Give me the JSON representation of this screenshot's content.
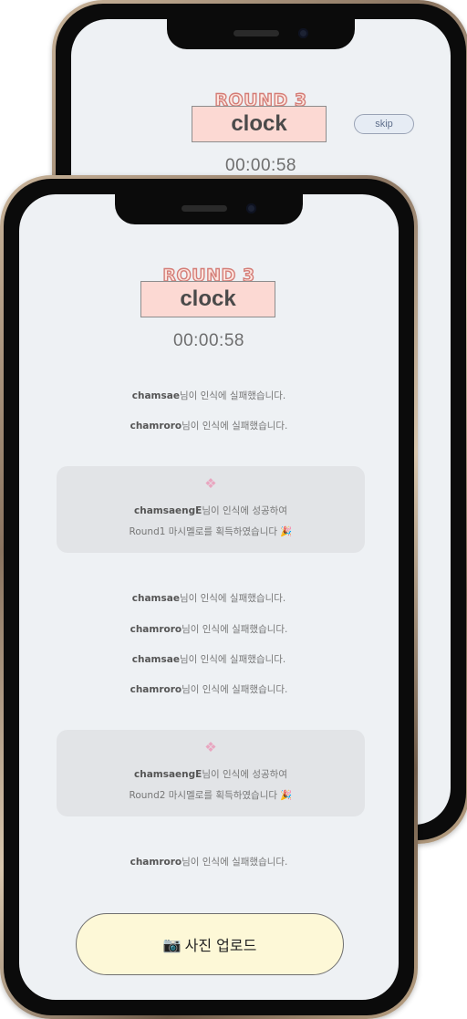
{
  "game": {
    "round_label": "ROUND 3",
    "word": "clock",
    "timer": "00:00:58",
    "skip_label": "skip"
  },
  "feed": [
    {
      "type": "fail",
      "user": "chamsae",
      "text": "님이 인식에 실패했습니다."
    },
    {
      "type": "fail",
      "user": "chamroro",
      "text": "님이 인식에 실패했습니다."
    },
    {
      "type": "success",
      "icon": "marshmallow-icon",
      "user": "chamsaengE",
      "text": "님이 인식에 성공하여",
      "reward": "Round1 마시멜로를 획득하였습니다",
      "reward_icon": "party-popper-icon"
    },
    {
      "type": "fail",
      "user": "chamsae",
      "text": "님이 인식에 실패했습니다."
    },
    {
      "type": "fail",
      "user": "chamroro",
      "text": "님이 인식에 실패했습니다."
    },
    {
      "type": "fail",
      "user": "chamsae",
      "text": "님이 인식에 실패했습니다."
    },
    {
      "type": "fail",
      "user": "chamroro",
      "text": "님이 인식에 실패했습니다."
    },
    {
      "type": "success",
      "icon": "marshmallow-icon",
      "user": "chamsaengE",
      "text": "님이 인식에 성공하여",
      "reward": "Round2 마시멜로를 획득하였습니다",
      "reward_icon": "party-popper-icon"
    },
    {
      "type": "fail",
      "user": "chamroro",
      "text": "님이 인식에 실패했습니다."
    }
  ],
  "upload": {
    "icon": "camera-icon",
    "label": "사진 업로드"
  },
  "colors": {
    "screen_bg": "#eef1f4",
    "word_box_bg": "#fcd9d3",
    "card_bg": "#e2e4e7",
    "upload_bg": "#fdf8d7",
    "round_stroke": "#d47d77"
  }
}
